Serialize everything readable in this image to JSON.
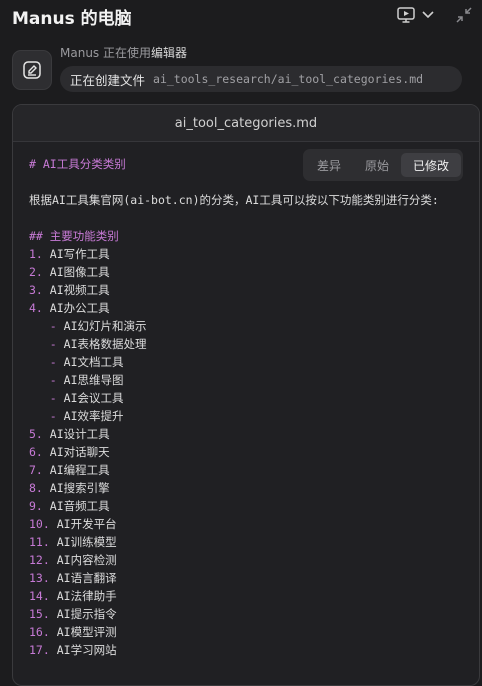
{
  "header": {
    "title": "Manus 的电脑",
    "icons": [
      "monitor-play-icon",
      "chevron-down-icon",
      "collapse-icon"
    ]
  },
  "activity": {
    "agent": "Manus",
    "status_text": "正在使用",
    "tool_name": "编辑器",
    "verb": "正在创建文件",
    "path": "ai_tools_research/ai_tool_categories.md"
  },
  "panel": {
    "filename": "ai_tool_categories.md",
    "tabs": [
      {
        "label": "差异"
      },
      {
        "label": "原始"
      },
      {
        "label": "已修改"
      }
    ],
    "active_tab": "已修改"
  },
  "document": {
    "heading": "# AI工具分类类别",
    "intro": "根据AI工具集官网(ai-bot.cn)的分类，AI工具可以按以下功能类别进行分类:",
    "section_heading": "## 主要功能类别",
    "items": [
      {
        "num": "1.",
        "text": "AI写作工具"
      },
      {
        "num": "2.",
        "text": "AI图像工具"
      },
      {
        "num": "3.",
        "text": "AI视频工具"
      },
      {
        "num": "4.",
        "text": "AI办公工具"
      }
    ],
    "sub_items": [
      {
        "dash": "-",
        "text": "AI幻灯片和演示"
      },
      {
        "dash": "-",
        "text": "AI表格数据处理"
      },
      {
        "dash": "-",
        "text": "AI文档工具"
      },
      {
        "dash": "-",
        "text": "AI思维导图"
      },
      {
        "dash": "-",
        "text": "AI会议工具"
      },
      {
        "dash": "-",
        "text": "AI效率提升"
      }
    ],
    "items2": [
      {
        "num": "5.",
        "text": "AI设计工具"
      },
      {
        "num": "6.",
        "text": "AI对话聊天"
      },
      {
        "num": "7.",
        "text": "AI编程工具"
      },
      {
        "num": "8.",
        "text": "AI搜索引擎"
      },
      {
        "num": "9.",
        "text": "AI音频工具"
      },
      {
        "num": "10.",
        "text": "AI开发平台"
      },
      {
        "num": "11.",
        "text": "AI训练模型"
      },
      {
        "num": "12.",
        "text": "AI内容检测"
      },
      {
        "num": "13.",
        "text": "AI语言翻译"
      },
      {
        "num": "14.",
        "text": "AI法律助手"
      },
      {
        "num": "15.",
        "text": "AI提示指令"
      },
      {
        "num": "16.",
        "text": "AI模型评测"
      },
      {
        "num": "17.",
        "text": "AI学习网站"
      }
    ]
  },
  "colors": {
    "background": "#1c1c1e",
    "panel": "#202023",
    "markdown_accent": "#c77ad6",
    "text": "#dcdcdc"
  }
}
